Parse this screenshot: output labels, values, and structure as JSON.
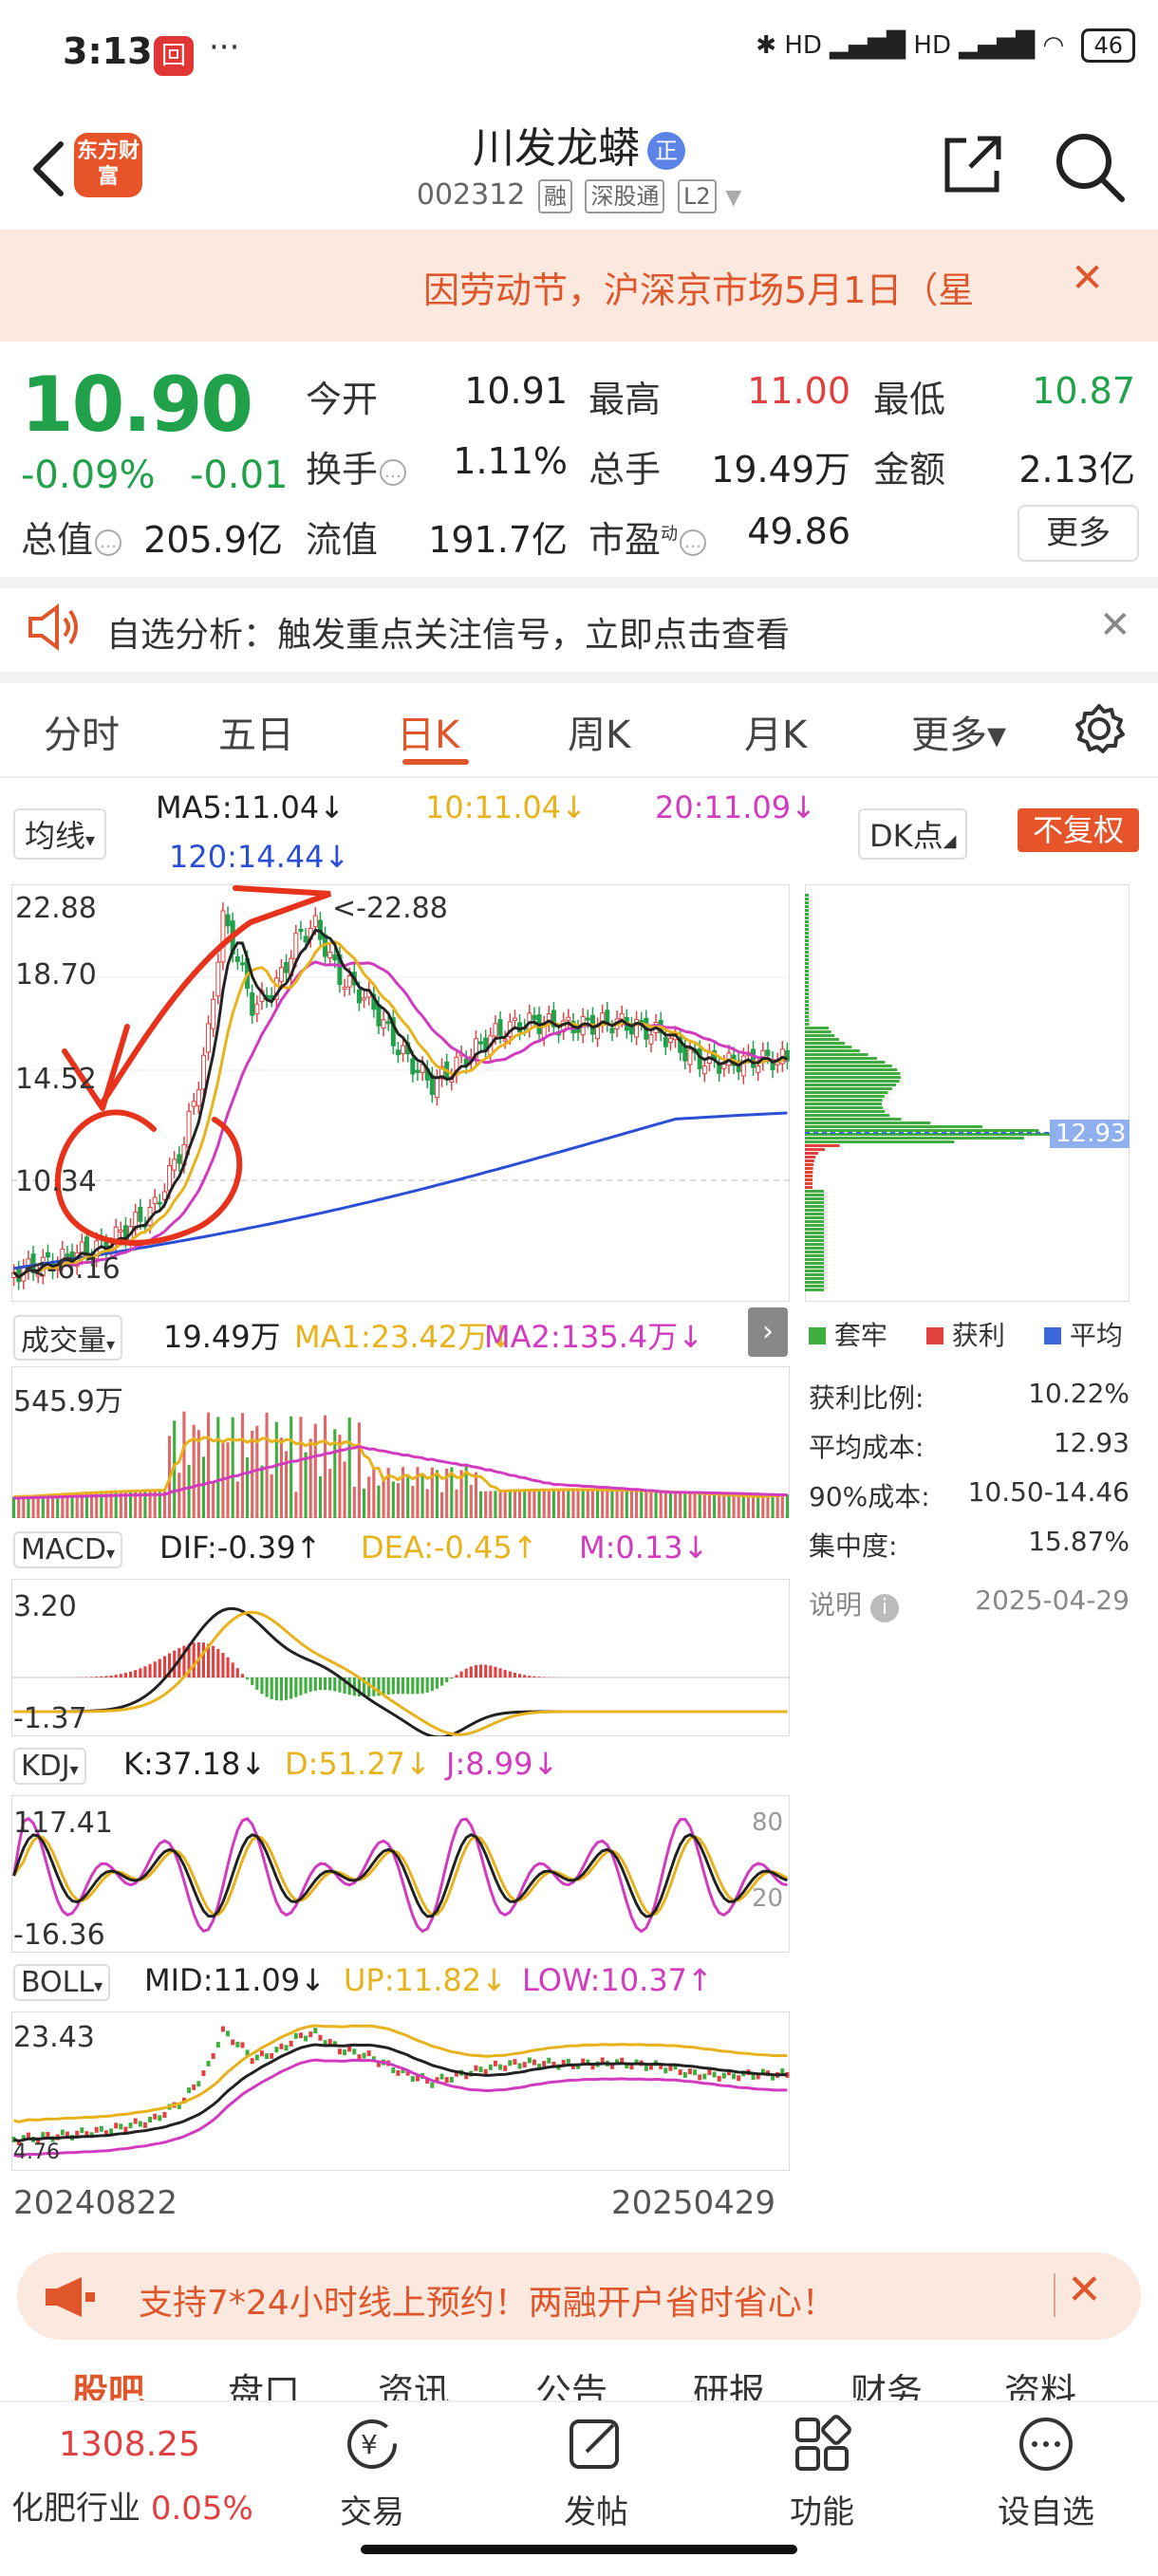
{
  "status_bar": {
    "time": "3:13",
    "app_badge": "回",
    "dots": "···",
    "signal_text": "HD ▂▄▆█ HD ▂▄▆█",
    "battery": "46"
  },
  "header": {
    "logo": "东方财富",
    "stock_name": "川发龙蟒",
    "name_badge": "正",
    "stock_code": "002312",
    "tags": [
      "融",
      "深股通",
      "L2"
    ]
  },
  "notice": {
    "text": "因劳动节，沪深京市场5月1日（星"
  },
  "quote": {
    "price": "10.90",
    "change_pct": "-0.09%",
    "change_abs": "-0.01",
    "fields": {
      "open_label": "今开",
      "open": "10.91",
      "high_label": "最高",
      "high": "11.00",
      "low_label": "最低",
      "low": "10.87",
      "turnover_label": "换手",
      "turnover": "1.11%",
      "volume_label": "总手",
      "volume": "19.49万",
      "amount_label": "金额",
      "amount": "2.13亿",
      "mktcap_label": "总值",
      "mktcap": "205.9亿",
      "float_label": "流值",
      "float": "191.7亿",
      "pe_label": "市盈",
      "pe_sup": "动",
      "pe": "49.86"
    },
    "more_label": "更多"
  },
  "analysis": {
    "text": "自选分析：触发重点关注信号，立即点击查看"
  },
  "tabs": [
    "分时",
    "五日",
    "日K",
    "周K",
    "月K",
    "更多▾"
  ],
  "active_tab": "日K",
  "chart_header": {
    "indicator_select": "均线",
    "ma5": "MA5:11.04↓",
    "ma10": "10:11.04↓",
    "ma20": "20:11.09↓",
    "ma120": "120:14.44↓",
    "dk_label": "DK点",
    "fuquan": "不复权"
  },
  "main_chart": {
    "y_ticks": [
      "22.88",
      "18.70",
      "14.52",
      "10.34",
      "6.16"
    ],
    "high_marker": "<-22.88",
    "low_marker": "<-6.16"
  },
  "volume_panel": {
    "select": "成交量",
    "vol": "19.49万",
    "ma1": "MA1:23.42万↓",
    "ma2": "MA2:135.4万↓",
    "y_top": "545.9万"
  },
  "macd_panel": {
    "select": "MACD",
    "dif": "DIF:-0.39↑",
    "dea": "DEA:-0.45↑",
    "m": "M:0.13↓",
    "y_top": "3.20",
    "y_bottom": "-1.37"
  },
  "kdj_panel": {
    "select": "KDJ",
    "k": "K:37.18↓",
    "d": "D:51.27↓",
    "j": "J:8.99↓",
    "y_top": "117.41",
    "y_bottom": "-16.36",
    "right_hi": "80",
    "right_lo": "20"
  },
  "boll_panel": {
    "select": "BOLL",
    "mid": "MID:11.09↓",
    "up": "UP:11.82↓",
    "low": "LOW:10.37↑",
    "y_top": "23.43",
    "y_bottom": "4.76"
  },
  "date_range": {
    "start": "20240822",
    "end": "20250429"
  },
  "chip_panel": {
    "price_marker": "12.93",
    "legend": [
      {
        "label": "套牢",
        "color": "#3fae3f"
      },
      {
        "label": "获利",
        "color": "#e04040"
      },
      {
        "label": "平均",
        "color": "#3a66d8"
      }
    ],
    "stats": [
      {
        "label": "获利比例:",
        "value": "10.22%"
      },
      {
        "label": "平均成本:",
        "value": "12.93"
      },
      {
        "label": "90%成本:",
        "value": "10.50-14.46"
      },
      {
        "label": "集中度:",
        "value": "15.87%"
      }
    ],
    "note_label": "说明",
    "note_date": "2025-04-29"
  },
  "banner": {
    "text": "支持7*24小时线上预约！两融开户省时省心！"
  },
  "section_tabs": [
    "股吧",
    "盘口",
    "资讯",
    "公告",
    "研报",
    "财务",
    "资料"
  ],
  "bottom_nav": {
    "index_value": "1308.25",
    "index_name": "化肥行业",
    "index_change": "0.05%",
    "items": [
      "交易",
      "发帖",
      "功能",
      "设自选"
    ]
  },
  "colors": {
    "up_red": "#e04040",
    "down_green": "#21a14a",
    "accent": "#e0562b",
    "ma5": "#222222",
    "ma10": "#e8b21b",
    "ma20": "#d23ac0",
    "ma120": "#2a4fd6"
  }
}
